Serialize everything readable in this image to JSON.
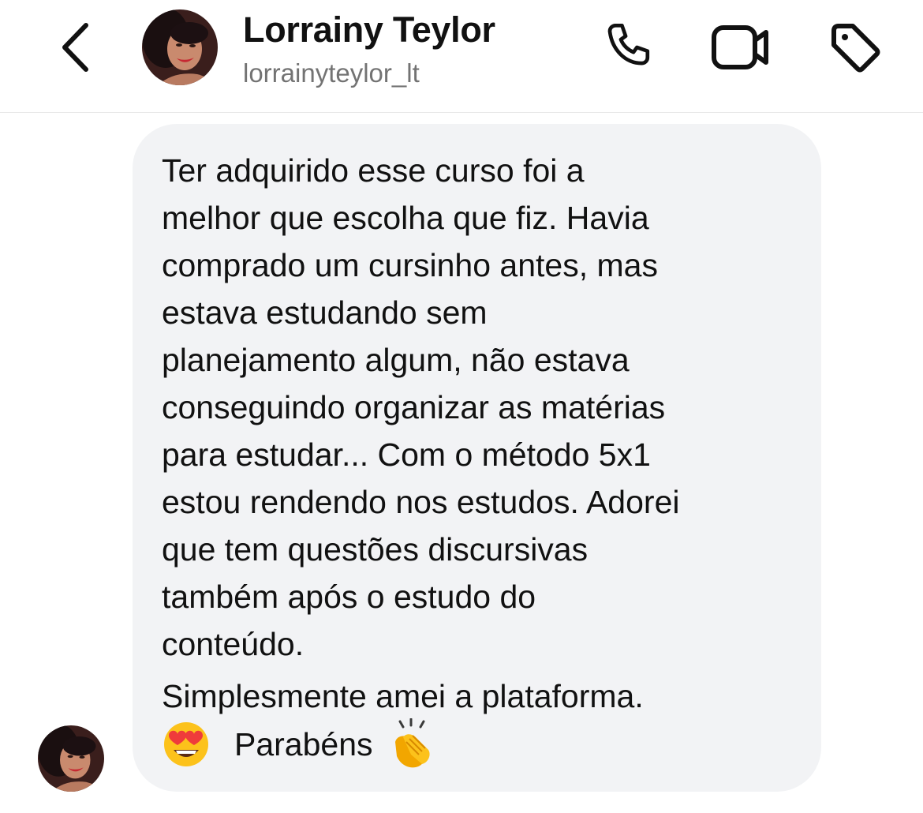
{
  "header": {
    "name": "Lorrainy Teylor",
    "handle": "lorrainyteylor_lt",
    "icons": {
      "back": "chevron-left-icon",
      "call": "phone-icon",
      "video": "video-camera-icon",
      "tag": "tag-icon"
    }
  },
  "message": {
    "body": "Ter adquirido esse curso foi a\nmelhor que escolha que fiz. Havia\ncomprado um cursinho antes, mas\nestava estudando sem\nplanejamento algum, não estava\nconseguindo organizar as matérias\npara estudar... Com o método 5x1\nestou rendendo nos estudos. Adorei\nque tem questões discursivas\ntambém após o estudo do\nconteúdo.",
    "closing": "Simplesmente amei a plataforma.",
    "final_text": "Parabéns",
    "emoji_start": "heart-eyes-emoji",
    "emoji_end": "clapping-hands-emoji"
  },
  "colors": {
    "bubble_bg": "#f2f3f5",
    "text": "#111111",
    "secondary_text": "#737373",
    "divider": "#e8e8e8"
  }
}
